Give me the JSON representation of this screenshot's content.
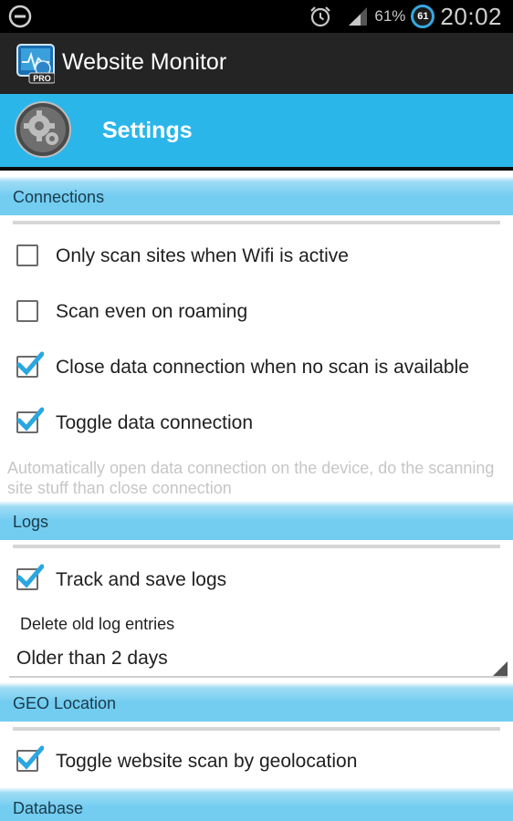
{
  "status_bar": {
    "battery_percent": "61%",
    "badge_value": "61",
    "time": "20:02",
    "icons": [
      "minus-circle-icon",
      "alarm-clock-icon",
      "signal-icon"
    ]
  },
  "app": {
    "title": "Website Monitor",
    "icon": "website-monitor-pro-icon"
  },
  "header": {
    "title": "Settings",
    "icon": "gear-icon"
  },
  "categories": {
    "connections": "Connections",
    "logs": "Logs",
    "geo": "GEO Location",
    "database": "Database"
  },
  "connections": [
    {
      "label": "Only scan sites when Wifi is active",
      "checked": false
    },
    {
      "label": "Scan even on roaming",
      "checked": false
    },
    {
      "label": "Close data connection when no scan is available",
      "checked": true
    },
    {
      "label": "Toggle data connection",
      "checked": true
    }
  ],
  "connections_summary": "Automatically open data connection on the device, do the scanning site stuff than close connection",
  "logs": {
    "track": {
      "label": "Track and save logs",
      "checked": true
    },
    "delete_label": "Delete old log entries",
    "delete_value": "Older than 2 days"
  },
  "geo": {
    "toggle": {
      "label": "Toggle website scan by geolocation",
      "checked": true
    }
  },
  "colors": {
    "header_blue": "#2bb6ea",
    "category_blue": "#72cdf1",
    "checkmark": "#2aa7e0"
  }
}
